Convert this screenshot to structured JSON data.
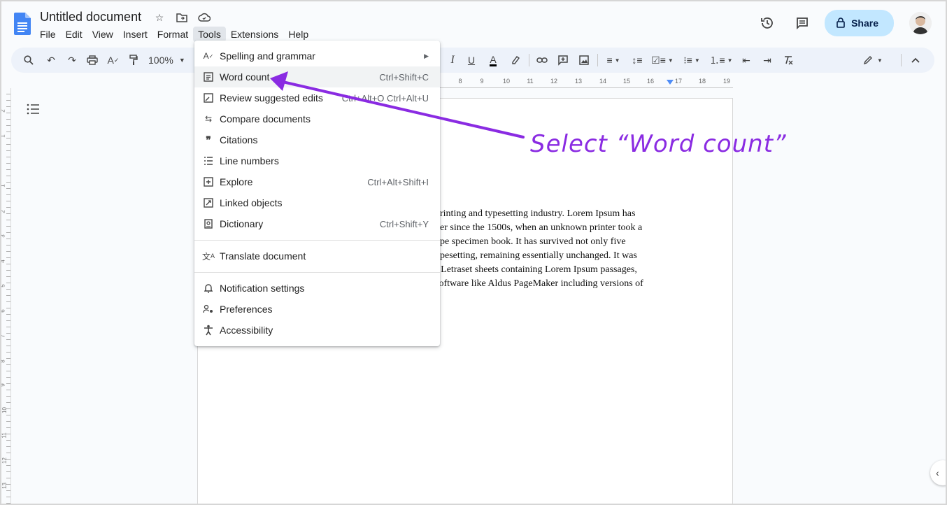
{
  "document": {
    "title": "Untitled document"
  },
  "menubar": [
    "File",
    "Edit",
    "View",
    "Insert",
    "Format",
    "Tools",
    "Extensions",
    "Help"
  ],
  "header": {
    "share_label": "Share"
  },
  "toolbar": {
    "zoom": "100%"
  },
  "ruler": [
    "8",
    "9",
    "10",
    "11",
    "12",
    "13",
    "14",
    "15",
    "16",
    "17",
    "18",
    "19"
  ],
  "vruler": [
    "2",
    "1",
    "1",
    "2",
    "3",
    "4",
    "5",
    "6",
    "7",
    "8",
    "9",
    "10",
    "11",
    "12",
    "13"
  ],
  "tools_menu": {
    "items": [
      {
        "label": "Spelling and grammar",
        "shortcut": "",
        "submenu": true
      },
      {
        "label": "Word count",
        "shortcut": "Ctrl+Shift+C",
        "highlighted": true
      },
      {
        "label": "Review suggested edits",
        "shortcut": "Ctrl+Alt+O Ctrl+Alt+U"
      },
      {
        "label": "Compare documents",
        "shortcut": ""
      },
      {
        "label": "Citations",
        "shortcut": ""
      },
      {
        "label": "Line numbers",
        "shortcut": ""
      },
      {
        "label": "Explore",
        "shortcut": "Ctrl+Alt+Shift+I"
      },
      {
        "label": "Linked objects",
        "shortcut": ""
      },
      {
        "label": "Dictionary",
        "shortcut": "Ctrl+Shift+Y"
      },
      {
        "label": "Translate document",
        "shortcut": ""
      },
      {
        "label": "Notification settings",
        "shortcut": ""
      },
      {
        "label": "Preferences",
        "shortcut": ""
      },
      {
        "label": "Accessibility",
        "shortcut": ""
      }
    ]
  },
  "body_lines": [
    "printing and typesetting industry. Lorem Ipsum has",
    "ver since the 1500s, when an unknown printer took a",
    "ype specimen book. It has survived not only five",
    "ypesetting, remaining essentially unchanged. It was",
    "f Letraset sheets containing Lorem Ipsum passages,",
    " software like Aldus PageMaker including versions of"
  ],
  "annotation": {
    "text": "Select “Word count”",
    "color": "#8a2be2"
  },
  "colors": {
    "share_bg": "#c2e7ff",
    "toolbar_bg": "#edf2fa",
    "doc_blue": "#4285f4"
  }
}
